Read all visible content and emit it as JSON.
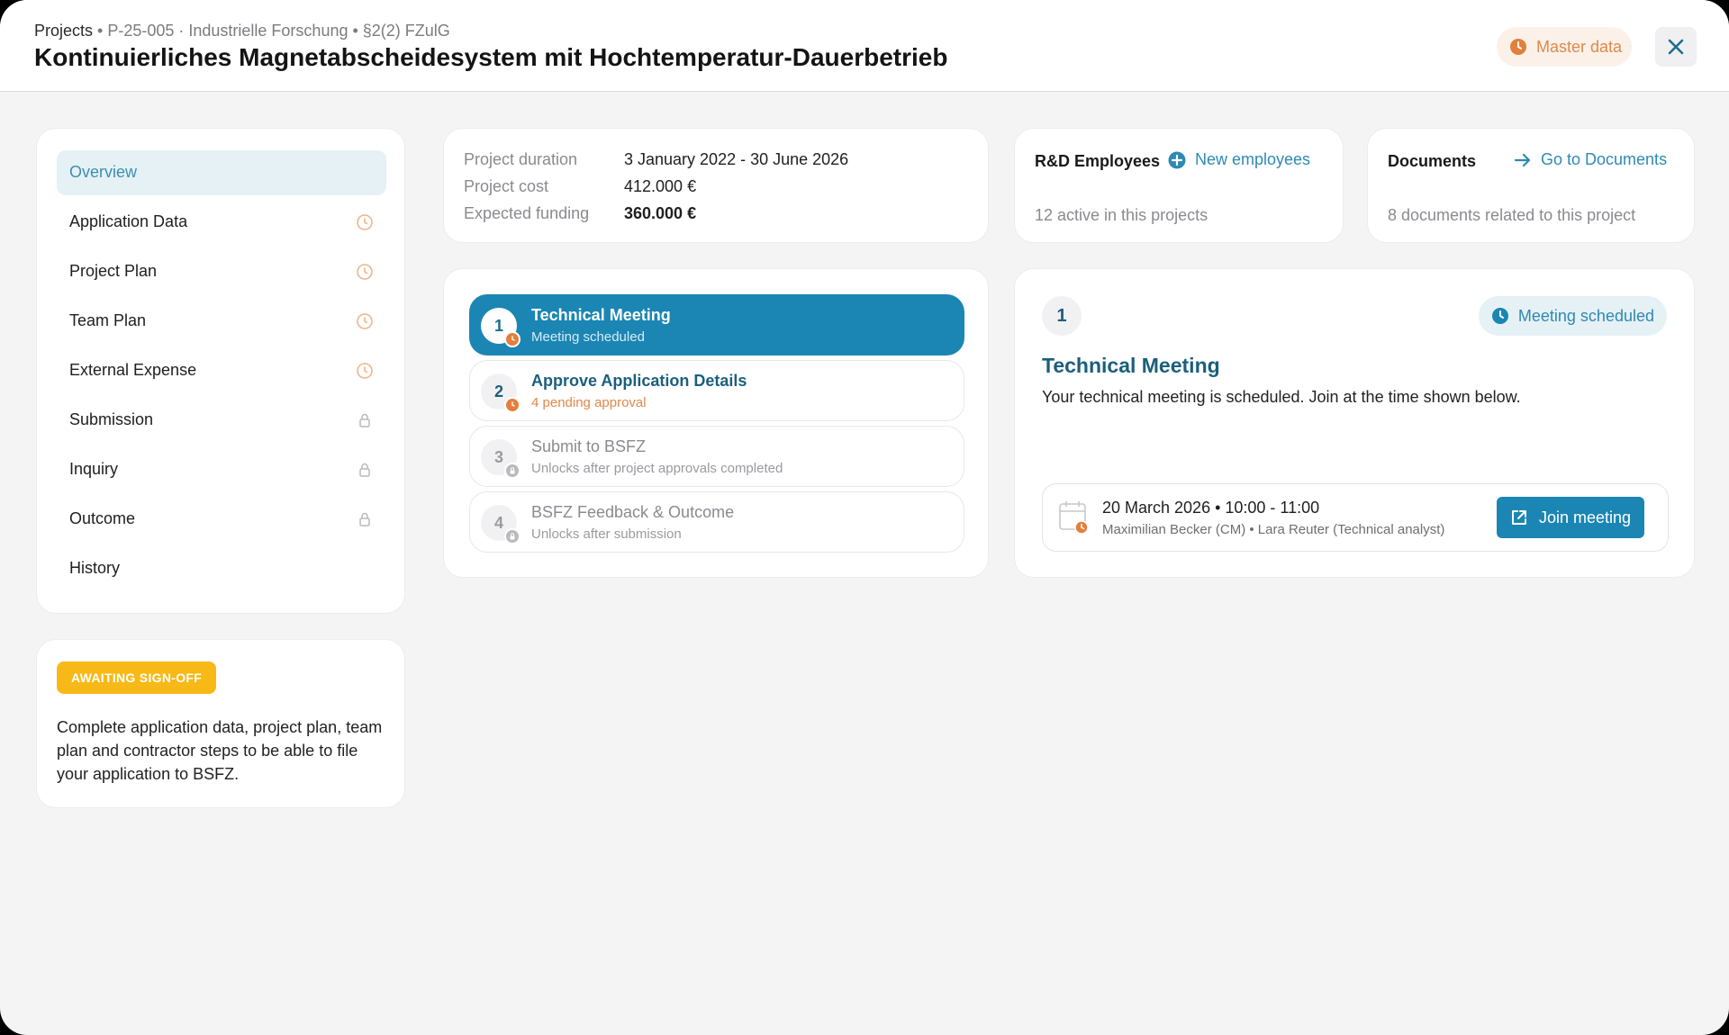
{
  "header": {
    "breadcrumb_root": "Projects",
    "breadcrumb_rest": " • P-25-005 · Industrielle Forschung • §2(2) FZulG",
    "title": "Kontinuierliches Magnetabscheidesystem mit Hochtemperatur-Dauerbetrieb",
    "master_data_label": "Master data"
  },
  "nav": {
    "items": [
      {
        "label": "Overview",
        "state": "active"
      },
      {
        "label": "Application Data",
        "icon": "clock-icon"
      },
      {
        "label": "Project Plan",
        "icon": "clock-icon"
      },
      {
        "label": "Team Plan",
        "icon": "clock-icon"
      },
      {
        "label": "External Expense",
        "icon": "clock-icon"
      },
      {
        "label": "Submission",
        "icon": "lock-icon"
      },
      {
        "label": "Inquiry",
        "icon": "lock-icon"
      },
      {
        "label": "Outcome",
        "icon": "lock-icon"
      },
      {
        "label": "History"
      }
    ]
  },
  "signoff": {
    "badge": "AWAITING SIGN-OFF",
    "text": "Complete application data, project plan, team plan and contractor steps to be able to file your application to BSFZ."
  },
  "project_info": {
    "duration_label": "Project duration",
    "duration_value": "3 January 2022 - 30 June 2026",
    "cost_label": "Project cost",
    "cost_value": "412.000 €",
    "funding_label": "Expected funding",
    "funding_value": "360.000 €"
  },
  "employees": {
    "title": "R&D Employees",
    "link": "New employees",
    "sub": "12 active in this projects"
  },
  "documents": {
    "title": "Documents",
    "link": "Go to Documents",
    "sub": "8 documents related to this project"
  },
  "steps": [
    {
      "num": "1",
      "title": "Technical Meeting",
      "sub": "Meeting scheduled",
      "state": "active"
    },
    {
      "num": "2",
      "title": "Approve Application Details",
      "sub": "4 pending approval",
      "state": "pending"
    },
    {
      "num": "3",
      "title": "Submit to BSFZ",
      "sub": "Unlocks after project approvals completed",
      "state": "locked"
    },
    {
      "num": "4",
      "title": "BSFZ Feedback & Outcome",
      "sub": "Unlocks after submission",
      "state": "locked"
    }
  ],
  "detail": {
    "num": "1",
    "status": "Meeting scheduled",
    "title": "Technical Meeting",
    "desc": "Your technical meeting is scheduled. Join at the time shown below.",
    "meeting_date": "20 March 2026 • 10:00 - 11:00",
    "meeting_people": "Maximilian Becker (CM) • Lara Reuter (Technical analyst)",
    "join_label": "Join meeting"
  },
  "colors": {
    "accent": "#1b86b3",
    "accent_dark": "#1b5f7d",
    "warning": "#e0884a",
    "badge": "#f7b917"
  }
}
